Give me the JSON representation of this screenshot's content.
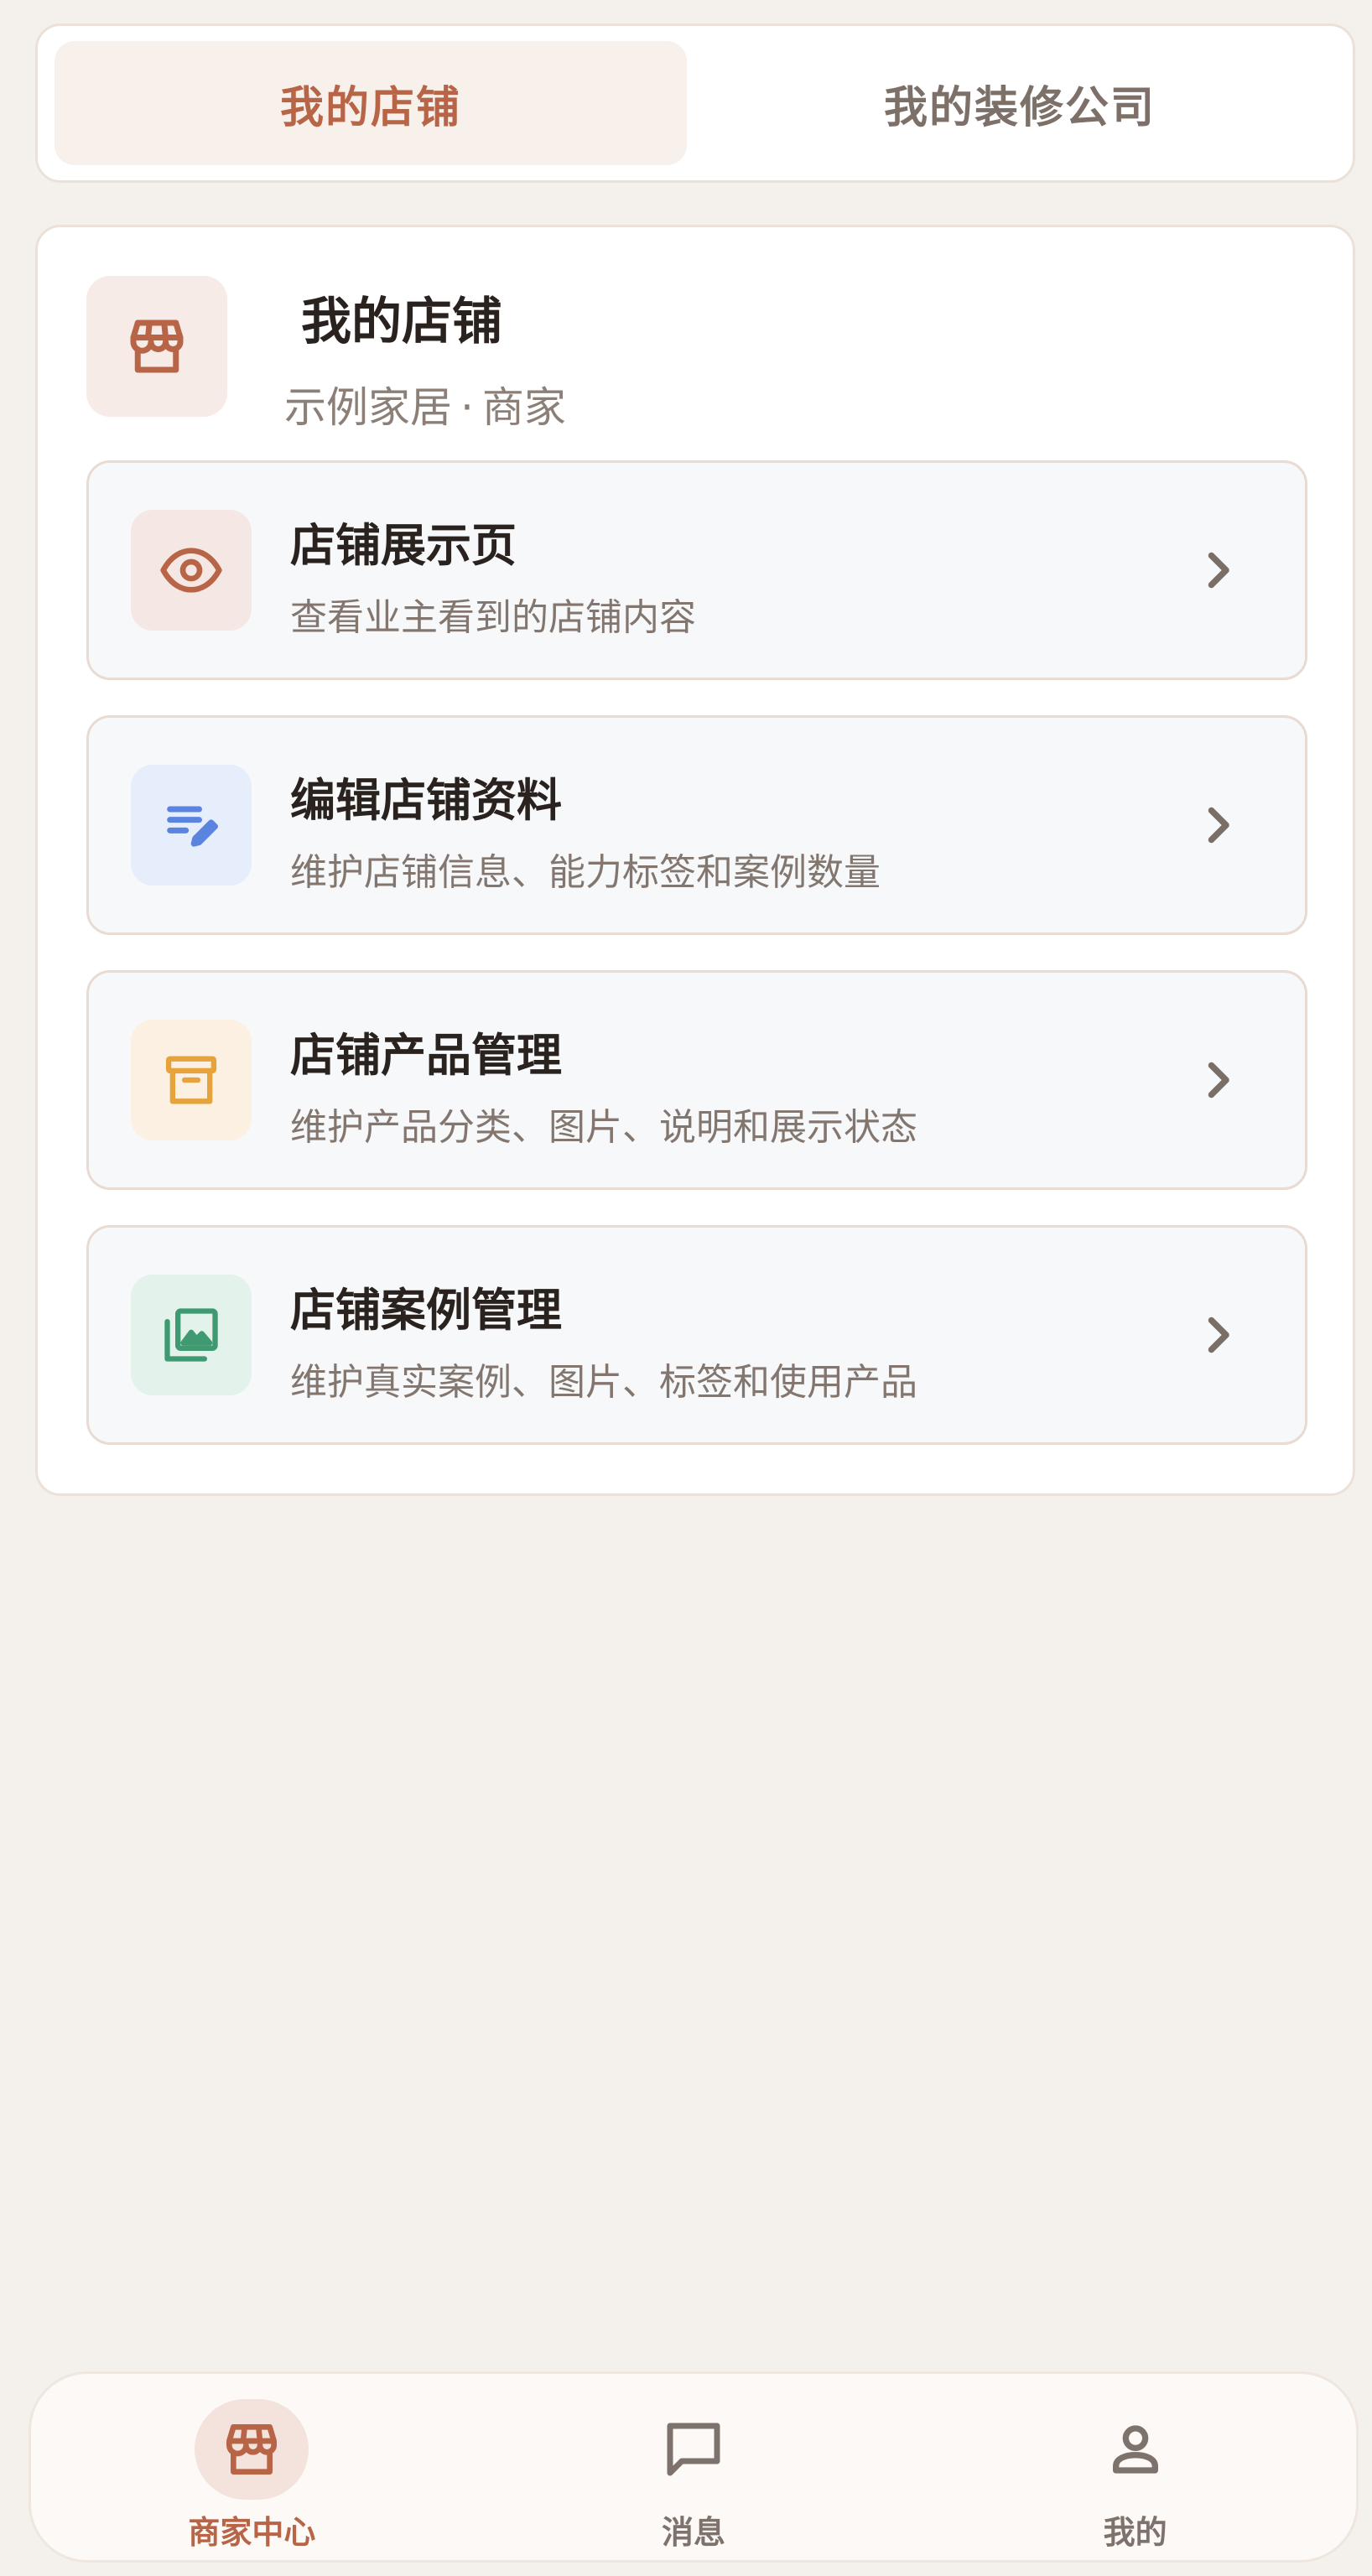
{
  "tabs": [
    {
      "label": "我的店铺",
      "active": true
    },
    {
      "label": "我的装修公司",
      "active": false
    }
  ],
  "shop": {
    "icon": "storefront-icon",
    "title": "我的店铺",
    "subtitle_name": "示例家居",
    "subtitle_sep": "·",
    "subtitle_role": "商家"
  },
  "items": [
    {
      "title": "店铺展示页",
      "desc": "查看业主看到的店铺内容",
      "icon": "eye-icon",
      "icon_color": "#b86547",
      "icon_bg": "#f5e8e4"
    },
    {
      "title": "编辑店铺资料",
      "desc": "维护店铺信息、能力标签和案例数量",
      "icon": "edit-note-icon",
      "icon_color": "#5b84e0",
      "icon_bg": "#e6edfb"
    },
    {
      "title": "店铺产品管理",
      "desc": "维护产品分类、图片、说明和展示状态",
      "icon": "archive-box-icon",
      "icon_color": "#e6a33c",
      "icon_bg": "#fbf0e1"
    },
    {
      "title": "店铺案例管理",
      "desc": "维护真实案例、图片、标签和使用产品",
      "icon": "photo-library-icon",
      "icon_color": "#3f9a72",
      "icon_bg": "#e3f2ea"
    }
  ],
  "nav": [
    {
      "label": "商家中心",
      "icon": "storefront-icon",
      "active": true
    },
    {
      "label": "消息",
      "icon": "chat-bubble-icon",
      "active": false
    },
    {
      "label": "我的",
      "icon": "person-icon",
      "active": false
    }
  ]
}
